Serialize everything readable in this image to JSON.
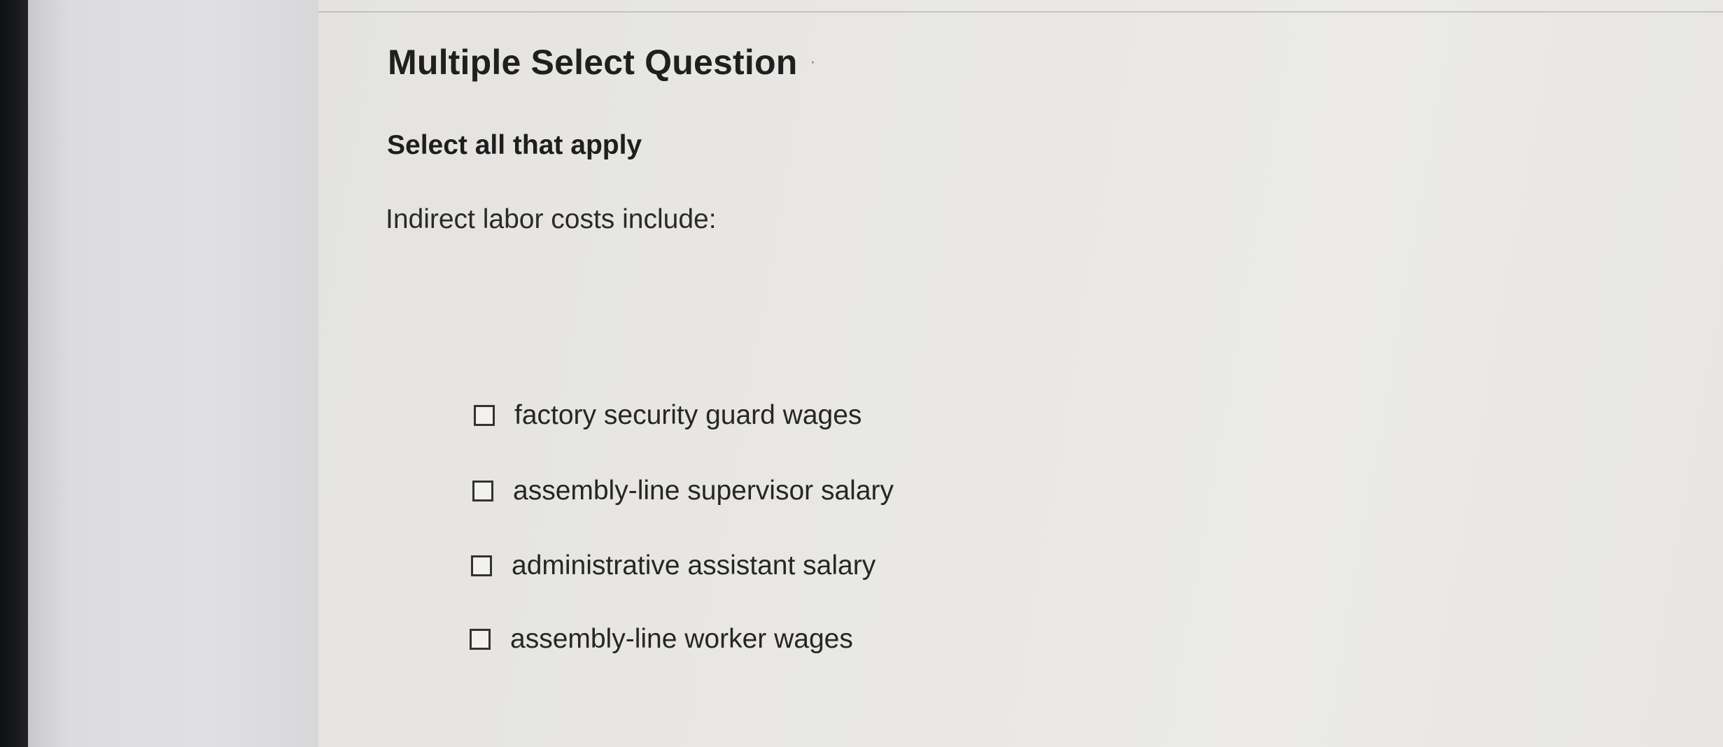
{
  "question": {
    "type_title": "Multiple Select Question",
    "instruction": "Select all that apply",
    "prompt": "Indirect labor costs include:",
    "choices": [
      {
        "label": "factory security guard wages",
        "checked": false
      },
      {
        "label": "assembly-line supervisor salary",
        "checked": false
      },
      {
        "label": "administrative assistant salary",
        "checked": false
      },
      {
        "label": "assembly-line worker wages",
        "checked": false
      }
    ]
  },
  "colors": {
    "page_background": "#e8e7e4",
    "text": "#1f1f1f",
    "checkbox_border": "#333333"
  }
}
